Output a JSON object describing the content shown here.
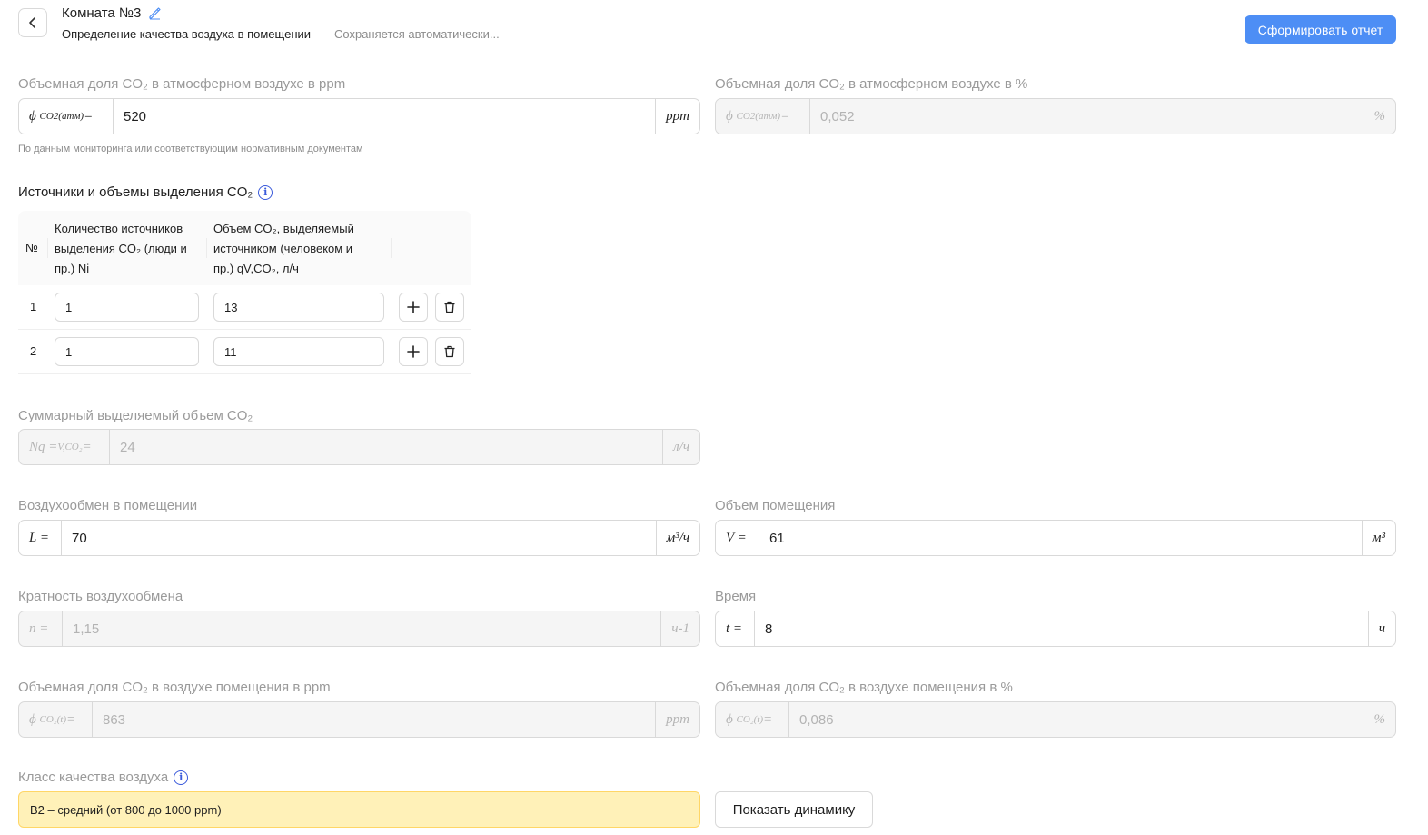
{
  "header": {
    "title": "Комната №3",
    "subtitle": "Определение качества воздуха в помещении",
    "autosave": "Сохраняется автоматически...",
    "report_button": "Сформировать отчет"
  },
  "co2_atm_ppm": {
    "label": "Объемная доля CO₂ в атмосферном воздухе в ppm",
    "prefix_main": "ϕ",
    "prefix_sub": "CO2(атм)",
    "prefix_eq": "=",
    "value": "520",
    "unit": "ppm",
    "hint": "По данным мониторинга или соответствующим нормативным документам"
  },
  "co2_atm_pct": {
    "label": "Объемная доля CO₂ в атмосферном воздухе в %",
    "prefix_main": "ϕ",
    "prefix_sub": "CO2(атм)",
    "prefix_eq": "=",
    "value": "0,052",
    "unit": "%"
  },
  "sources": {
    "title": "Источники и объемы выделения CO₂",
    "columns": {
      "no": "№",
      "count_line1": "Количество источников",
      "count_line2": "выделения CO₂ (люди и",
      "count_line3": "пр.) Ni",
      "volume_line1": "Объем CO₂, выделяемый",
      "volume_line2": "источником (человеком и",
      "volume_line3": "пр.) qV,CO₂, л/ч"
    },
    "rows": [
      {
        "no": "1",
        "count": "1",
        "volume": "13"
      },
      {
        "no": "2",
        "count": "1",
        "volume": "11"
      }
    ]
  },
  "total_volume": {
    "label": "Суммарный выделяемый объем CO₂",
    "prefix_main": "Nq =",
    "prefix_sub": "V,CO₂",
    "prefix_eq": "=",
    "value": "24",
    "unit": "л/ч"
  },
  "air_exchange": {
    "label": "Воздухообмен в помещении",
    "prefix": "L =",
    "value": "70",
    "unit": "м³/ч"
  },
  "room_volume": {
    "label": "Объем помещения",
    "prefix": "V =",
    "value": "61",
    "unit": "м³"
  },
  "exchange_rate": {
    "label": "Кратность воздухообмена",
    "prefix": "n =",
    "value": "1,15",
    "unit": "ч-1"
  },
  "time": {
    "label": "Время",
    "prefix": "t =",
    "value": "8",
    "unit": "ч"
  },
  "co2_room_ppm": {
    "label": "Объемная доля CO₂ в воздухе помещения в ppm",
    "prefix_main": "ϕ",
    "prefix_sub": "CO₂(t)",
    "prefix_eq": "=",
    "value": "863",
    "unit": "ppm"
  },
  "co2_room_pct": {
    "label": "Объемная доля CO₂ в воздухе помещения в %",
    "prefix_main": "ϕ",
    "prefix_sub": "CO₂(t)",
    "prefix_eq": "=",
    "value": "0,086",
    "unit": "%"
  },
  "air_quality": {
    "label": "Класс качества воздуха",
    "value": "В2 – средний (от 800 до 1000 ppm)",
    "dynamics_button": "Показать динамику"
  },
  "colors": {
    "primary": "#4d8ef5",
    "quality_bg": "#fff1b8",
    "quality_border": "#ffd666",
    "info": "#3b5bdb"
  }
}
